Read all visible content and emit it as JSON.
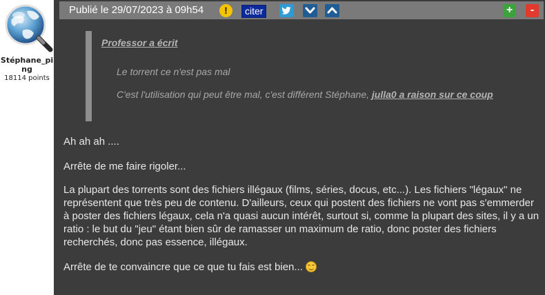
{
  "author": {
    "name": "Stéphane_ping",
    "points": "18114 points"
  },
  "header": {
    "date": "Publié le 29/07/2023 à 09h54",
    "alert_symbol": "!",
    "quote_label": "citer",
    "plus_label": "+",
    "minus_label": "-",
    "icons": [
      "alert-icon",
      "twitter-icon",
      "chevron-down-icon",
      "chevron-up-icon",
      "plus-icon",
      "minus-icon"
    ]
  },
  "quote": {
    "author_line": "Professor a écrit",
    "line1": "Le torrent ce n'est pas mal",
    "line2_text": "C'est l'utilisation qui peut être mal, c'est différent Stéphane, ",
    "line2_link": "julla0 a raison sur ce coup"
  },
  "body": {
    "p1": "Ah ah ah ....",
    "p2": "Arrête de me faire rigoler...",
    "p3": "La plupart des torrents sont des fichiers illégaux (films, séries, docus, etc...). Les fichiers \"légaux\" ne représentent que très peu de contenu. D'ailleurs, ceux qui postent des fichiers ne vont pas s'emmerder à poster des fichiers légaux, cela n'a quasi aucun intérêt, surtout si, comme la plupart des sites, il y a un ratio : le but du \"jeu\" étant bien sûr de ramasser un maximum de ratio, donc poster des fichiers recherchés, donc pas essence, illégaux.",
    "p4": "Arrête de te convaincre que ce que tu fais est bien... "
  },
  "colors": {
    "background": "#3c3c3c",
    "header": "#7a7a7a",
    "quote_button": "#0b2a9c",
    "twitter": "#2f9bd6",
    "arrows": "#1f5d94",
    "plus": "#3aa33a",
    "minus": "#e23b2e"
  }
}
